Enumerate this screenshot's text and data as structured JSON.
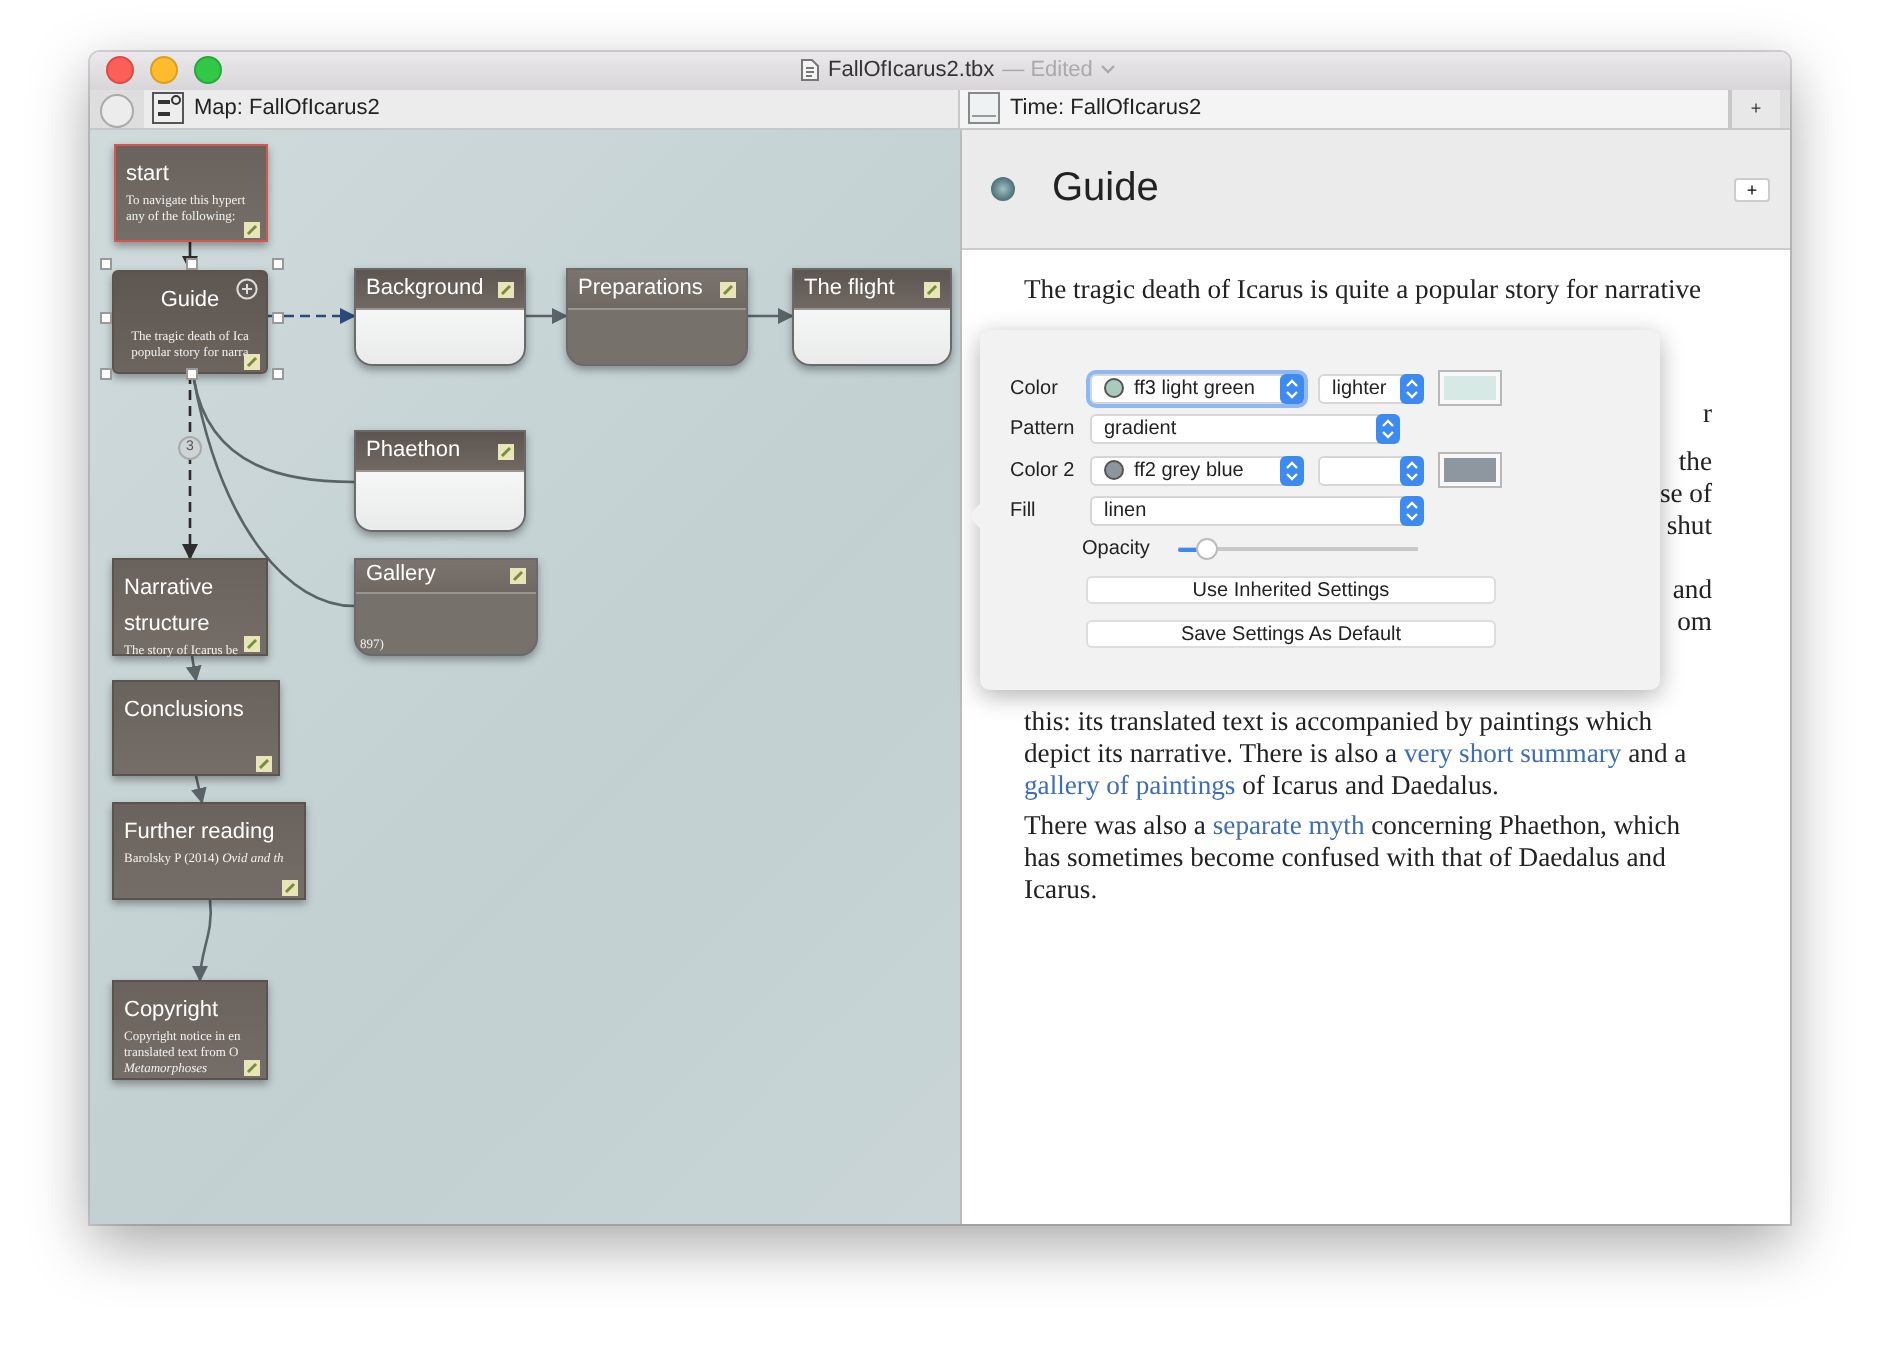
{
  "window": {
    "title": "FallOfIcarus2.tbx",
    "title_status": "— Edited"
  },
  "tabs": [
    {
      "label": "Map: FallOfIcarus2",
      "kind": "map",
      "selected": true
    },
    {
      "label": "Time: FallOfIcarus2",
      "kind": "timeline",
      "selected": false
    }
  ],
  "new_tab_button": "+",
  "map": {
    "nodes": [
      {
        "title": "start",
        "kind": "note",
        "lines": [
          "To navigate this hypert",
          "any of the following:"
        ],
        "color": "#d9534f",
        "selected": false
      },
      {
        "title": "Guide",
        "kind": "note",
        "lines": [
          "The tragic death of Ica",
          "popular story for narra"
        ],
        "color": "#5a534e",
        "selected": true
      },
      {
        "title": "Background",
        "kind": "rounded-light",
        "color": "#6a6a6a",
        "selected": false
      },
      {
        "title": "Preparations",
        "kind": "rounded-dark",
        "color": "#6a6a6a",
        "selected": false
      },
      {
        "title": "The flight",
        "kind": "rounded-light",
        "color": "#6a6a6a",
        "selected": false
      },
      {
        "title": "Phaethon",
        "kind": "rounded-light",
        "color": "#6a6a6a",
        "selected": false
      },
      {
        "title": "Narrative structure",
        "kind": "note",
        "lines": [
          "The story of Icarus be"
        ],
        "color": "#5a534e",
        "selected": false
      },
      {
        "title": "Gallery",
        "kind": "rounded-dark",
        "lines": [
          "897)"
        ],
        "color": "#6a6a6a",
        "selected": false
      },
      {
        "title": "Conclusions",
        "kind": "note",
        "color": "#5a534e",
        "selected": false
      },
      {
        "title": "Further reading",
        "kind": "note",
        "lines": [
          "Barolsky P (2014) *Ovid and th*"
        ],
        "color": "#5a534e",
        "selected": false
      },
      {
        "title": "Copyright",
        "kind": "note",
        "lines": [
          "Copyright notice in en",
          "translated text from O",
          "*Metamorphoses*"
        ],
        "color": "#5a534e",
        "selected": false
      }
    ],
    "badge": "3"
  },
  "note": {
    "title": "Guide",
    "add_button": "+",
    "intro_lines": [
      "The tragic death of Icarus is quite a popular story for narrative"
    ],
    "covered_fragments": [
      "r",
      "the",
      "se of",
      "shut",
      "and",
      "om"
    ],
    "paragraphs": [
      [
        {
          "text": "this: its translated text is accompanied by paintings which depict its narrative. There is also a ",
          "link": false
        },
        {
          "text": "very short summary",
          "link": true
        },
        {
          "text": " and a ",
          "link": false
        },
        {
          "text": "gallery of paintings",
          "link": true
        },
        {
          "text": " of Icarus and Daedalus.",
          "link": false
        }
      ],
      [
        {
          "text": "There was also a ",
          "link": false
        },
        {
          "text": "separate myth",
          "link": true
        },
        {
          "text": " concerning Phaethon, which has sometimes become confused with that of Daedalus and Icarus.",
          "link": false
        }
      ]
    ]
  },
  "settings_popover": {
    "rows": [
      {
        "kind": "color",
        "label": "Color",
        "value": "ff3 light green",
        "focused": true,
        "dot": {
          "color": "#a8cbbd"
        },
        "modifier": "lighter",
        "swatch": {
          "color": "#d6e9e4"
        }
      },
      {
        "kind": "select",
        "label": "Pattern",
        "value": "gradient"
      },
      {
        "kind": "color",
        "label": "Color 2",
        "value": "ff2 grey blue",
        "focused": false,
        "dot": {
          "color": "#8e959c"
        },
        "swatch": {
          "color": "#8e979f"
        }
      },
      {
        "kind": "select",
        "label": "Fill",
        "value": "linen"
      },
      {
        "kind": "slider",
        "label": "Opacity",
        "level": 0.12
      }
    ],
    "buttons": [
      "Use Inherited Settings",
      "Save Settings As Default"
    ]
  }
}
